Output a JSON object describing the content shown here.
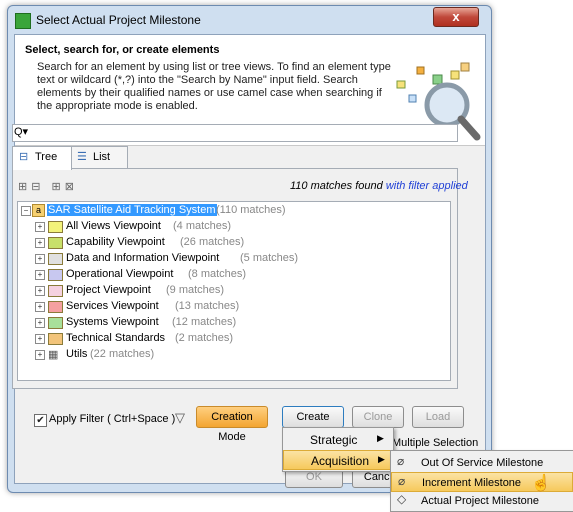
{
  "window": {
    "title": "Select Actual Project Milestone",
    "close_label": "x"
  },
  "header": {
    "title": "Select, search for, or create elements",
    "description": "Search for an element by using list or tree views. To find an element type text or wildcard (*,?) into the \"Search by Name\" input field. Search elements by their qualified names or use camel case when searching if the appropriate mode is enabled."
  },
  "search": {
    "value": "",
    "icon": "search-icon"
  },
  "tabs": [
    {
      "label": "Tree",
      "icon": "tree-icon"
    },
    {
      "label": "List",
      "icon": "list-icon"
    }
  ],
  "matches": {
    "text": "110 matches found ",
    "filter_text": "with filter applied"
  },
  "tree": {
    "root": {
      "label": "SAR Satellite Aid Tracking System",
      "count": "(110 matches)"
    },
    "children": [
      {
        "label": "All Views Viewpoint",
        "count": "(4 matches)",
        "color": "#f2f27a"
      },
      {
        "label": "Capability Viewpoint",
        "count": "(26 matches)",
        "color": "#c8e06a"
      },
      {
        "label": "Data and Information Viewpoint",
        "count": "(5 matches)",
        "color": "#e0e0e0"
      },
      {
        "label": "Operational Viewpoint",
        "count": "(8 matches)",
        "color": "#c8c8f0"
      },
      {
        "label": "Project Viewpoint",
        "count": "(9 matches)",
        "color": "#f5d2e0"
      },
      {
        "label": "Services Viewpoint",
        "count": "(13 matches)",
        "color": "#f4a0a0"
      },
      {
        "label": "Systems Viewpoint",
        "count": "(12 matches)",
        "color": "#a8e09a"
      },
      {
        "label": "Technical Standards",
        "count": "(2 matches)",
        "color": "#f2c47a"
      },
      {
        "label": "Utils",
        "count": "(22 matches)",
        "color": "#ffffff"
      }
    ]
  },
  "bottom": {
    "apply_filter_label": "Apply Filter ( Ctrl+Space )",
    "apply_filter_checked": true,
    "creation_mode": "Creation Mode",
    "create": "Create",
    "clone": "Clone",
    "load": "Load",
    "multiple_selection": "Multiple Selection",
    "ok": "OK",
    "cancel": "Cancel"
  },
  "create_menu": [
    {
      "label": "Strategic",
      "has_submenu": true,
      "highlighted": false
    },
    {
      "label": "Acquisition",
      "has_submenu": true,
      "highlighted": true
    }
  ],
  "acquisition_menu": [
    {
      "label": "Out Of Service Milestone",
      "icon": "milestone-icon",
      "highlighted": false
    },
    {
      "label": "Increment Milestone",
      "icon": "milestone-icon",
      "highlighted": true
    },
    {
      "label": "Actual Project Milestone",
      "icon": "diamond-icon",
      "highlighted": false
    }
  ]
}
